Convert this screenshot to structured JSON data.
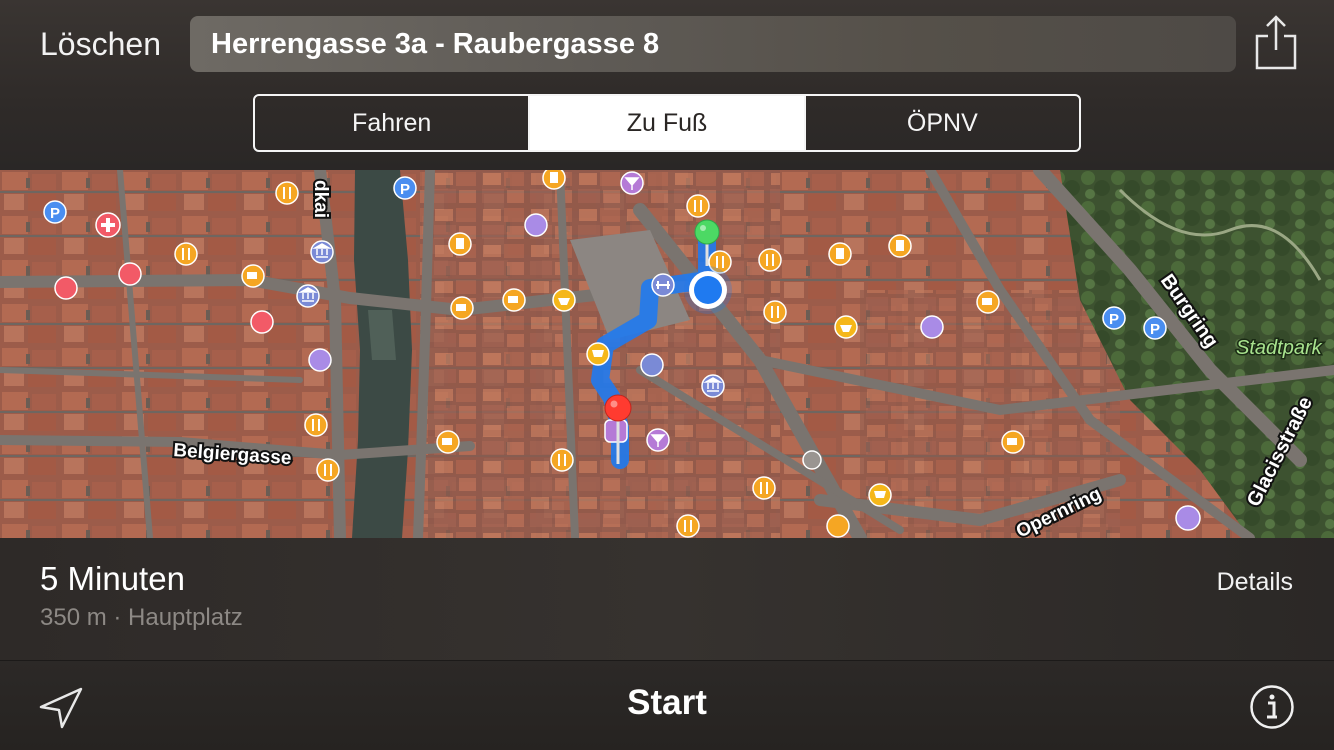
{
  "header": {
    "clear_label": "Löschen",
    "route_text": "Herrengasse 3a - Raubergasse 8",
    "share_icon": "share-icon",
    "transport_modes": [
      {
        "label": "Fahren",
        "active": false
      },
      {
        "label": "Zu Fuß",
        "active": true
      },
      {
        "label": "ÖPNV",
        "active": false
      }
    ]
  },
  "map": {
    "street_labels": {
      "belgiergasse": "Belgiergasse",
      "kai": "dkai",
      "burgring": "Burgring",
      "glacisstrasse": "Glacisstraße",
      "opernring": "Opernring",
      "stadtpark": "Stadtpark"
    },
    "route_color": "#1f7af0",
    "start_pin_color": "#4cd964",
    "end_pin_color": "#ff3b30",
    "poi_colors": {
      "food": "#f5a623",
      "shopping": "#f5b71a",
      "museum": "#7a8ad6",
      "hotel": "#a98be6",
      "health": "#f25a67",
      "parking": "#4a8ef0",
      "bar": "#b57ad6"
    }
  },
  "info": {
    "duration": "5 Minuten",
    "distance_destination": "350 m · Hauptplatz",
    "details_label": "Details"
  },
  "footer": {
    "locate_icon": "location-arrow-icon",
    "start_label": "Start",
    "info_icon": "info-icon"
  }
}
